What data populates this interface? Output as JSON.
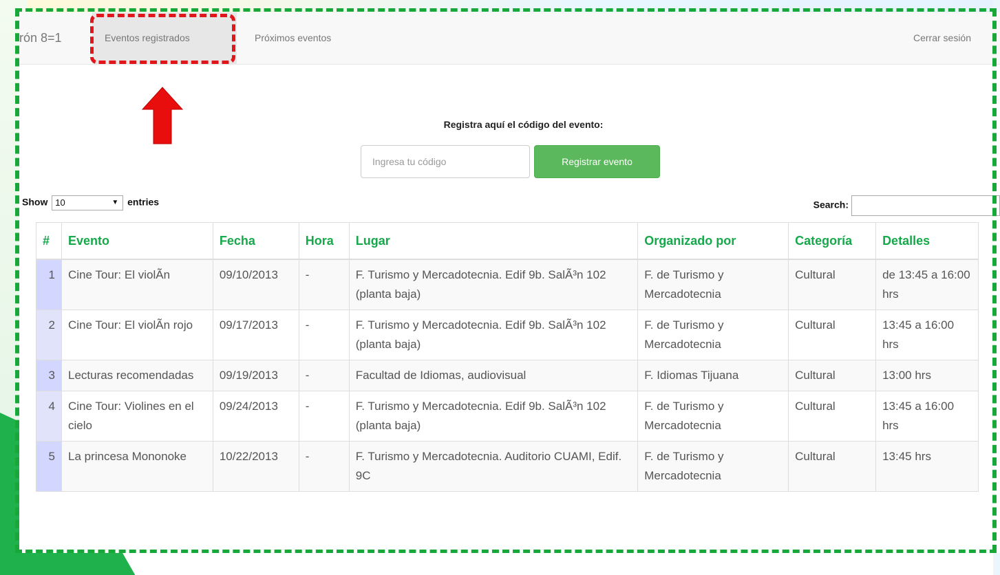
{
  "navbar": {
    "brand": "rón 8=1",
    "links": [
      "Eventos registrados",
      "Próximos eventos"
    ],
    "logout": "Cerrar sesión"
  },
  "register": {
    "label": "Registra aquí el código del evento:",
    "placeholder": "Ingresa tu código",
    "button": "Registrar evento"
  },
  "datatable": {
    "show_label": "Show",
    "entries_value": "10",
    "entries_label": "entries",
    "search_label": "Search:"
  },
  "table": {
    "headers": [
      "#",
      "Evento",
      "Fecha",
      "Hora",
      "Lugar",
      "Organizado por",
      "Categoría",
      "Detalles"
    ],
    "rows": [
      [
        "1",
        "Cine Tour: El violÃn",
        "09/10/2013",
        "-",
        "F. Turismo y Mercadotecnia. Edif 9b. SalÃ³n 102 (planta baja)",
        "F. de Turismo y Mercadotecnia",
        "Cultural",
        "de 13:45 a 16:00 hrs"
      ],
      [
        "2",
        "Cine Tour: El violÃn rojo",
        "09/17/2013",
        "-",
        "F. Turismo y Mercadotecnia. Edif 9b. SalÃ³n 102 (planta baja)",
        "F. de Turismo y Mercadotecnia",
        "Cultural",
        "13:45 a 16:00 hrs"
      ],
      [
        "3",
        "Lecturas recomendadas",
        "09/19/2013",
        "-",
        "Facultad de Idiomas, audiovisual",
        "F. Idiomas Tijuana",
        "Cultural",
        "13:00 hrs"
      ],
      [
        "4",
        "Cine Tour: Violines en el cielo",
        "09/24/2013",
        "-",
        "F. Turismo y Mercadotecnia. Edif 9b. SalÃ³n 102 (planta baja)",
        "F. de Turismo y Mercadotecnia",
        "Cultural",
        "13:45 a 16:00 hrs"
      ],
      [
        "5",
        "La princesa Mononoke",
        "10/22/2013",
        "-",
        "F. Turismo y Mercadotecnia. Auditorio CUAMI, Edif. 9C",
        "F. de Turismo y Mercadotecnia",
        "Cultural",
        "13:45 hrs"
      ]
    ]
  },
  "colors": {
    "accent_green": "#16a84a",
    "button_green": "#5cb85c",
    "annotation_red": "#e0161b",
    "frame_green": "#18a83a"
  },
  "icons": {
    "annotation": "red-up-arrow-icon",
    "select_caret": "caret-down-icon"
  }
}
